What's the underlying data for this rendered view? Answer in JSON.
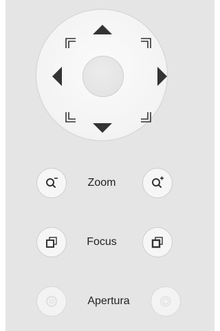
{
  "ptz": {
    "icons": {
      "up": "triangle-up-icon",
      "down": "triangle-down-icon",
      "left": "triangle-left-icon",
      "right": "triangle-right-icon",
      "up_left": "corner-up-left-icon",
      "up_right": "corner-up-right-icon",
      "down_left": "corner-down-left-icon",
      "down_right": "corner-down-right-icon"
    }
  },
  "controls": {
    "zoom": {
      "label": "Zoom",
      "out_icon": "zoom-out-icon",
      "in_icon": "zoom-in-icon"
    },
    "focus": {
      "label": "Focus",
      "near_icon": "focus-near-icon",
      "far_icon": "focus-far-icon"
    },
    "aperture": {
      "label": "Apertura",
      "close_icon": "aperture-close-icon",
      "open_icon": "aperture-open-icon",
      "state": "disabled"
    }
  },
  "colors": {
    "panel_bg": "#e5e5e5",
    "arrow": "#333333",
    "disabled_icon": "#e2e2e2"
  }
}
